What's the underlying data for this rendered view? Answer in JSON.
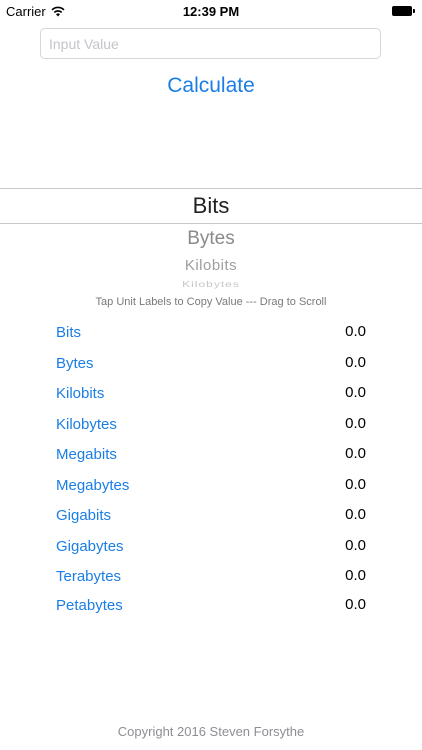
{
  "status_bar": {
    "carrier": "Carrier",
    "time": "12:39 PM",
    "wifi_icon": "wifi-icon",
    "battery_icon": "battery-icon"
  },
  "input": {
    "placeholder": "Input Value",
    "value": ""
  },
  "calculate_button": {
    "label": "Calculate",
    "color": "#1a7ee6"
  },
  "picker": {
    "selected": "Bits",
    "items": [
      "Bits",
      "Bytes",
      "Kilobits",
      "Kilobytes"
    ]
  },
  "hint": "Tap Unit Labels to Copy Value --- Drag to Scroll",
  "results": [
    {
      "unit": "Bits",
      "value": "0.0"
    },
    {
      "unit": "Bytes",
      "value": "0.0"
    },
    {
      "unit": "Kilobits",
      "value": "0.0"
    },
    {
      "unit": "Kilobytes",
      "value": "0.0"
    },
    {
      "unit": "Megabits",
      "value": "0.0"
    },
    {
      "unit": "Megabytes",
      "value": "0.0"
    },
    {
      "unit": "Gigabits",
      "value": "0.0"
    },
    {
      "unit": "Gigabytes",
      "value": "0.0"
    },
    {
      "unit": "Terabytes",
      "value": "0.0"
    },
    {
      "unit": "Petabytes",
      "value": "0.0"
    }
  ],
  "footer": "Copyright 2016 Steven Forsythe"
}
